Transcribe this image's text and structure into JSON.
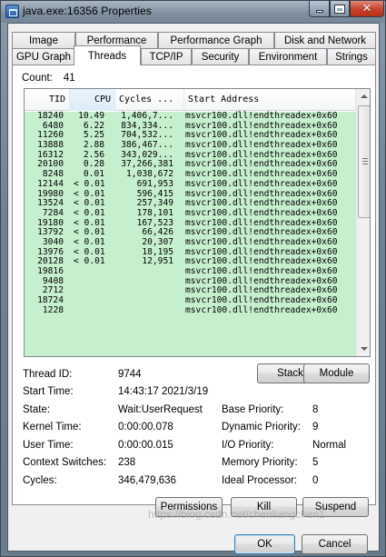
{
  "window": {
    "title": "java.exe:16356 Properties"
  },
  "tabs_row1": [
    "Image",
    "Performance",
    "Performance Graph",
    "Disk and Network"
  ],
  "tabs_row2": [
    "GPU Graph",
    "Threads",
    "TCP/IP",
    "Security",
    "Environment",
    "Strings"
  ],
  "selected_tab": "Threads",
  "count": {
    "label": "Count:",
    "value": "41"
  },
  "thread_list": {
    "columns": [
      "TID",
      "CPU",
      "Cycles ...",
      "Start Address"
    ],
    "sorted_column": "CPU",
    "row_color": "#c6efce",
    "rows": [
      {
        "tid": "18240",
        "cpu": "10.49",
        "cycles": "1,406,7...",
        "addr": "msvcr100.dll!endthreadex+0x60"
      },
      {
        "tid": "6480",
        "cpu": "6.22",
        "cycles": "834,334...",
        "addr": "msvcr100.dll!endthreadex+0x60"
      },
      {
        "tid": "11260",
        "cpu": "5.25",
        "cycles": "704,532...",
        "addr": "msvcr100.dll!endthreadex+0x60"
      },
      {
        "tid": "13888",
        "cpu": "2.88",
        "cycles": "386,467...",
        "addr": "msvcr100.dll!endthreadex+0x60"
      },
      {
        "tid": "16312",
        "cpu": "2.56",
        "cycles": "343,029...",
        "addr": "msvcr100.dll!endthreadex+0x60"
      },
      {
        "tid": "20100",
        "cpu": "0.28",
        "cycles": "37,266,381",
        "addr": "msvcr100.dll!endthreadex+0x60"
      },
      {
        "tid": "8248",
        "cpu": "0.01",
        "cycles": "1,038,672",
        "addr": "msvcr100.dll!endthreadex+0x60"
      },
      {
        "tid": "12144",
        "cpu": "< 0.01",
        "cycles": "691,953",
        "addr": "msvcr100.dll!endthreadex+0x60"
      },
      {
        "tid": "19980",
        "cpu": "< 0.01",
        "cycles": "596,415",
        "addr": "msvcr100.dll!endthreadex+0x60"
      },
      {
        "tid": "13524",
        "cpu": "< 0.01",
        "cycles": "257,349",
        "addr": "msvcr100.dll!endthreadex+0x60"
      },
      {
        "tid": "7284",
        "cpu": "< 0.01",
        "cycles": "178,101",
        "addr": "msvcr100.dll!endthreadex+0x60"
      },
      {
        "tid": "19180",
        "cpu": "< 0.01",
        "cycles": "167,523",
        "addr": "msvcr100.dll!endthreadex+0x60"
      },
      {
        "tid": "13792",
        "cpu": "< 0.01",
        "cycles": "66,426",
        "addr": "msvcr100.dll!endthreadex+0x60"
      },
      {
        "tid": "3040",
        "cpu": "< 0.01",
        "cycles": "20,307",
        "addr": "msvcr100.dll!endthreadex+0x60"
      },
      {
        "tid": "13976",
        "cpu": "< 0.01",
        "cycles": "18,195",
        "addr": "msvcr100.dll!endthreadex+0x60"
      },
      {
        "tid": "20128",
        "cpu": "< 0.01",
        "cycles": "12,951",
        "addr": "msvcr100.dll!endthreadex+0x60"
      },
      {
        "tid": "19816",
        "cpu": "",
        "cycles": "",
        "addr": "msvcr100.dll!endthreadex+0x60"
      },
      {
        "tid": "9408",
        "cpu": "",
        "cycles": "",
        "addr": "msvcr100.dll!endthreadex+0x60"
      },
      {
        "tid": "2712",
        "cpu": "",
        "cycles": "",
        "addr": "msvcr100.dll!endthreadex+0x60"
      },
      {
        "tid": "18724",
        "cpu": "",
        "cycles": "",
        "addr": "msvcr100.dll!endthreadex+0x60"
      },
      {
        "tid": "1228",
        "cpu": "",
        "cycles": "",
        "addr": "msvcr100.dll!endthreadex+0x60"
      }
    ]
  },
  "details": {
    "thread_id_label": "Thread ID:",
    "thread_id": "9744",
    "start_time_label": "Start Time:",
    "start_time": "14:43:17   2021/3/19",
    "state_label": "State:",
    "state": "Wait:UserRequest",
    "kernel_time_label": "Kernel Time:",
    "kernel_time": "0:00:00.078",
    "user_time_label": "User Time:",
    "user_time": "0:00:00.015",
    "context_switches_label": "Context Switches:",
    "context_switches": "238",
    "cycles_label": "Cycles:",
    "cycles": "346,479,636",
    "base_priority_label": "Base Priority:",
    "base_priority": "8",
    "dynamic_priority_label": "Dynamic Priority:",
    "dynamic_priority": "9",
    "io_priority_label": "I/O Priority:",
    "io_priority": "Normal",
    "memory_priority_label": "Memory Priority:",
    "memory_priority": "5",
    "ideal_processor_label": "Ideal Processor:",
    "ideal_processor": "0"
  },
  "buttons": {
    "stack": "Stack",
    "module": "Module",
    "permissions": "Permissions",
    "kill": "Kill",
    "suspend": "Suspend",
    "ok": "OK",
    "cancel": "Cancel"
  },
  "watermark": "https://blog.csdn.net/chenliangchen1"
}
